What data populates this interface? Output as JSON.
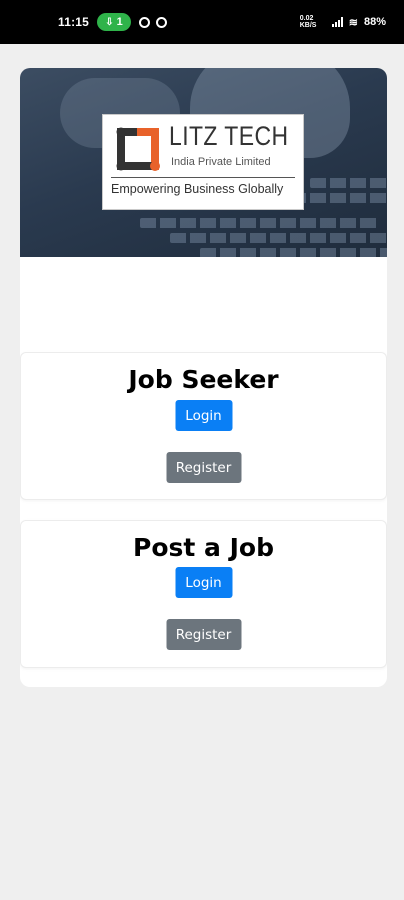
{
  "status_bar": {
    "time": "11:15",
    "pill_count": "1",
    "data_rate": "0.02 KB/S",
    "battery": "88%"
  },
  "logo": {
    "title": "LITZ TECH",
    "subtitle": "India Private Limited",
    "tagline": "Empowering Business Globally",
    "colors": {
      "orange": "#e8622a",
      "dark": "#333333"
    }
  },
  "sections": [
    {
      "title": "Job Seeker",
      "login_label": "Login",
      "register_label": "Register"
    },
    {
      "title": "Post a Job",
      "login_label": "Login",
      "register_label": "Register"
    }
  ],
  "colors": {
    "login_button": "#0a7ff5",
    "register_button": "#6c757d",
    "page_background": "#efefef"
  }
}
